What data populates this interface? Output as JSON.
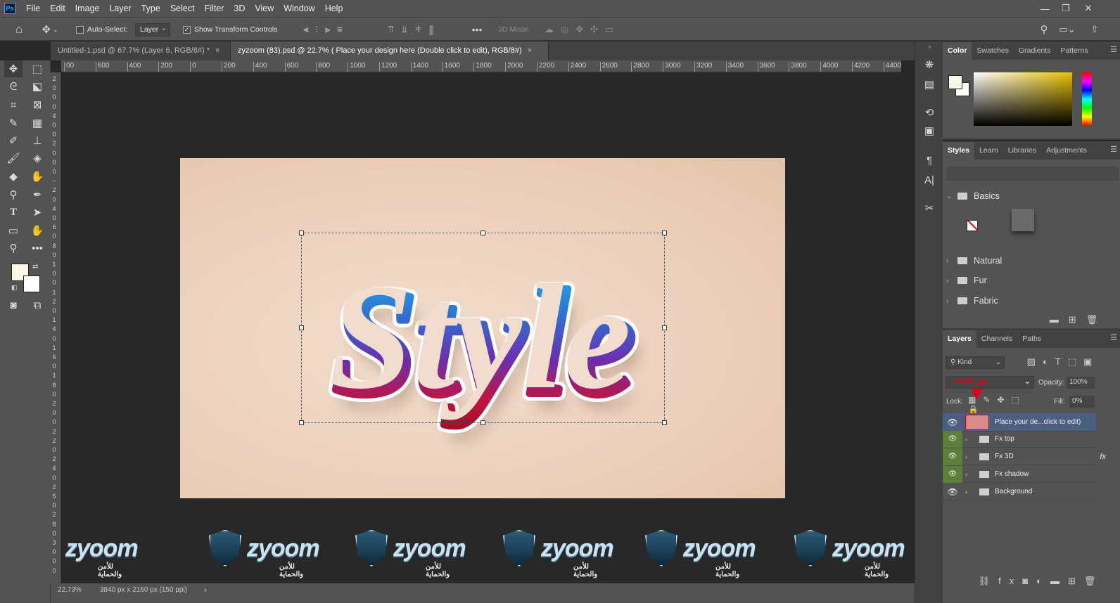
{
  "menu": [
    "File",
    "Edit",
    "Image",
    "Layer",
    "Type",
    "Select",
    "Filter",
    "3D",
    "View",
    "Window",
    "Help"
  ],
  "options": {
    "auto_select_label": "Auto-Select:",
    "layer_dropdown": "Layer",
    "show_transform_label": "Show Transform Controls",
    "mode3d_label": "3D Mode:"
  },
  "tabs": [
    {
      "label": "Untitled-1.psd @ 67.7% (Layer 6, RGB/8#) *",
      "close": "×"
    },
    {
      "label": "zyzoom (83).psd @ 22.7% ( Place your design here (Double click to edit), RGB/8#)",
      "close": "×"
    }
  ],
  "ruler_h": [
    "00",
    "600",
    "400",
    "200",
    "0",
    "200",
    "400",
    "600",
    "800",
    "1000",
    "1200",
    "1400",
    "1600",
    "1800",
    "2000",
    "2200",
    "2400",
    "2600",
    "2800",
    "3000",
    "3200",
    "3400",
    "3600",
    "3800",
    "4000",
    "4200",
    "4400"
  ],
  "ruler_v": [
    "2",
    "0",
    "0",
    "0",
    "4",
    "0",
    "0",
    "2",
    "0",
    "0",
    "0",
    "–",
    "2",
    "0",
    "4",
    "0",
    "6",
    "0",
    "8",
    "0",
    "1",
    "0",
    "0",
    "1",
    "2",
    "0",
    "1",
    "4",
    "0",
    "1",
    "6",
    "0",
    "1",
    "8",
    "0",
    "2",
    "0",
    "0",
    "2",
    "2",
    "0",
    "2",
    "4",
    "0",
    "2",
    "6",
    "0",
    "2",
    "8",
    "0",
    "3",
    "0",
    "0",
    "0"
  ],
  "artwork": {
    "text": "Style"
  },
  "watermark": {
    "brand": "zyoom",
    "sub": "للأمن والحماية",
    "count": 6
  },
  "status": {
    "zoom": "22.73%",
    "doc": "3840 px x 2160 px (150 ppi)",
    "arrow": "›"
  },
  "color_panel": {
    "tabs": [
      "Color",
      "Swatches",
      "Gradients",
      "Patterns"
    ],
    "fg": "#fbf7e8",
    "bg": "#ffffff"
  },
  "styles_panel": {
    "tabs": [
      "Styles",
      "Learn",
      "Libraries",
      "Adjustments"
    ],
    "folders": [
      "Basics",
      "Natural",
      "Fur",
      "Fabric"
    ]
  },
  "layers_panel": {
    "tabs": [
      "Layers",
      "Channels",
      "Paths"
    ],
    "filter_label": "Kind",
    "blend_label": "ميل كالقاف",
    "opacity_label": "Opacity:",
    "opacity_value": "100%",
    "lock_label": "Lock:",
    "fill_label": "Fill:",
    "fill_value": "0%",
    "layers": [
      {
        "name": "Place your de...click to edit)",
        "type": "smart",
        "selected": true
      },
      {
        "name": "Fx top",
        "type": "group"
      },
      {
        "name": "Fx 3D",
        "type": "group",
        "fx": "fx"
      },
      {
        "name": "Fx shadow",
        "type": "group"
      },
      {
        "name": "Background",
        "type": "group"
      }
    ]
  },
  "colors": {
    "accent": "#31a8ff",
    "layer_selected": "#4b5f80",
    "eye_green": "#5c7f3a",
    "red_arrow": "#e2001a"
  }
}
